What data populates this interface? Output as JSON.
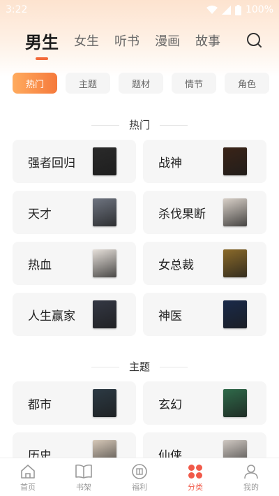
{
  "status_bar": {
    "time": "3:22",
    "battery": "100%"
  },
  "top_nav": {
    "tabs": [
      {
        "label": "男生",
        "active": true
      },
      {
        "label": "女生"
      },
      {
        "label": "听书"
      },
      {
        "label": "漫画"
      },
      {
        "label": "故事"
      }
    ]
  },
  "chips": [
    {
      "label": "热门",
      "active": true
    },
    {
      "label": "主题"
    },
    {
      "label": "题材"
    },
    {
      "label": "情节"
    },
    {
      "label": "角色"
    }
  ],
  "sections": [
    {
      "title": "热门",
      "items": [
        {
          "label": "强者回归",
          "cover_color": "#2a2a2a"
        },
        {
          "label": "战神",
          "cover_color": "#3a2418"
        },
        {
          "label": "天才",
          "cover_color": "#6e7480"
        },
        {
          "label": "杀伐果断",
          "cover_color": "#d8d0c8"
        },
        {
          "label": "热血",
          "cover_color": "#e6e0da"
        },
        {
          "label": "女总裁",
          "cover_color": "#8a6a2a"
        },
        {
          "label": "人生赢家",
          "cover_color": "#343844"
        },
        {
          "label": "神医",
          "cover_color": "#1a2a4a"
        }
      ]
    },
    {
      "title": "主题",
      "items": [
        {
          "label": "都市",
          "cover_color": "#2c3a44"
        },
        {
          "label": "玄幻",
          "cover_color": "#2f6a4a"
        },
        {
          "label": "历史",
          "cover_color": "#d6c8b8"
        },
        {
          "label": "仙侠",
          "cover_color": "#cfc8c2"
        }
      ]
    }
  ],
  "bottom_nav": [
    {
      "label": "首页",
      "icon": "home-icon"
    },
    {
      "label": "书架",
      "icon": "bookshelf-icon"
    },
    {
      "label": "福利",
      "icon": "gift-icon"
    },
    {
      "label": "分类",
      "icon": "category-icon",
      "active": true
    },
    {
      "label": "我的",
      "icon": "profile-icon"
    }
  ],
  "colors": {
    "accent": "#f26a3a",
    "active_nav": "#f15a4a",
    "chip_active_start": "#ffab5e",
    "chip_active_end": "#f5793b"
  }
}
